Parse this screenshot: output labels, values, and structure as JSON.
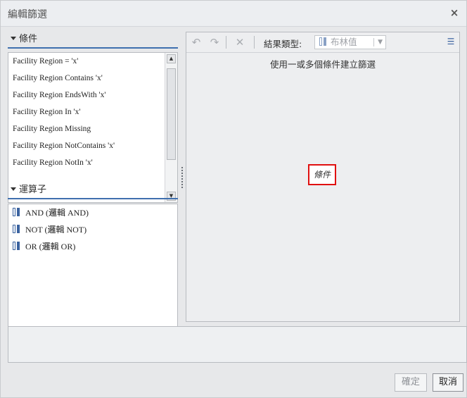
{
  "dialog": {
    "title": "編輯篩選",
    "close_glyph": "×"
  },
  "left": {
    "conditions_header": "條件",
    "conditions": [
      "Facility Region = 'x'",
      "Facility Region Contains 'x'",
      "Facility Region EndsWith 'x'",
      "Facility Region In 'x'",
      "Facility Region Missing",
      "Facility Region NotContains 'x'",
      "Facility Region NotIn 'x'"
    ],
    "operators_header": "運算子",
    "operators": [
      "AND (邏輯 AND)",
      "NOT (邏輯 NOT)",
      "OR (邏輯 OR)"
    ]
  },
  "toolbar": {
    "undo_icon": "undo-icon",
    "redo_icon": "redo-icon",
    "delete_icon": "delete-icon",
    "result_type_label": "結果類型:",
    "result_type_value": "布林值",
    "menu_icon": "menu-icon"
  },
  "canvas": {
    "hint": "使用一或多個條件建立篩選",
    "placeholder": "條件"
  },
  "footer": {
    "ok_label": "確定",
    "cancel_label": "取消"
  },
  "colors": {
    "accent": "#3f6fae",
    "placeholder_border": "#e01010",
    "bool_icon": "#3b63a0"
  }
}
